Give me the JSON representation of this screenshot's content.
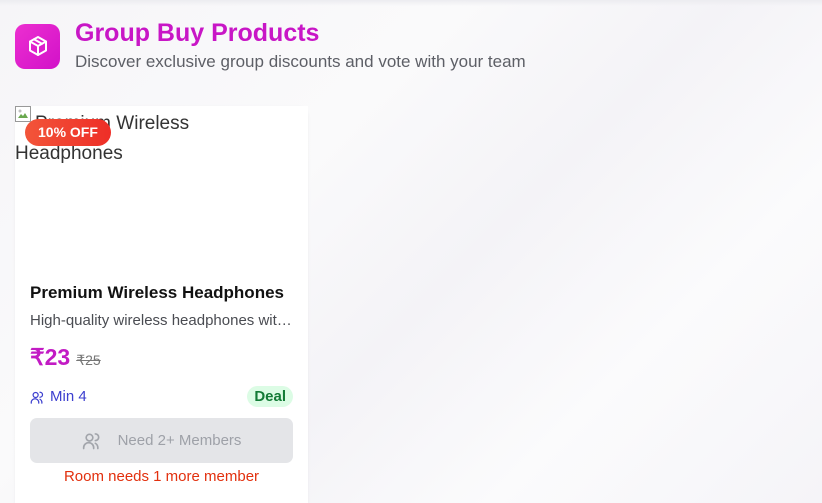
{
  "header": {
    "title": "Group Buy Products",
    "subtitle": "Discover exclusive group discounts and vote with your team",
    "logo_icon": "package-icon",
    "logo_color": "#e024cc"
  },
  "product": {
    "image_alt": "Premium Wireless Headphones",
    "discount_badge": "10% OFF",
    "name": "Premium Wireless Headphones",
    "description": "High-quality wireless headphones with noise cancellation",
    "price": "₹23",
    "original_price": "₹25",
    "min_members": "Min 4",
    "deal_label": "Deal",
    "join_button_label": "Need 2+ Members",
    "room_status": "Room needs 1 more member"
  },
  "colors": {
    "accent": "#c816c6",
    "badge": "#ef3b2c",
    "deal_bg": "#dcfce5",
    "status": "#e2300e"
  }
}
